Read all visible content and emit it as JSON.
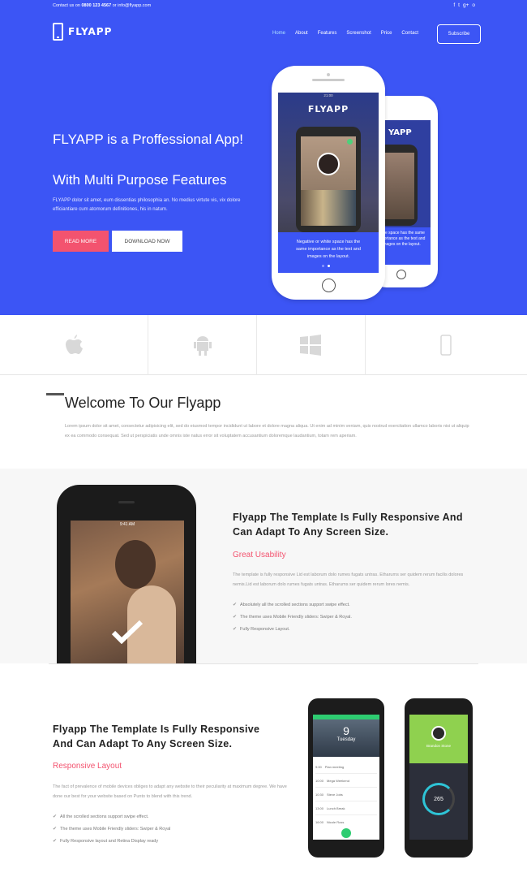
{
  "topbar": {
    "contact_prefix": "Contact us on",
    "phone": "0800 123 4567",
    "or": "or",
    "email": "info@flyapp.com"
  },
  "social_icons": [
    "facebook-icon",
    "twitter-icon",
    "googleplus-icon",
    "github-icon"
  ],
  "social_glyphs": [
    "f",
    "t",
    "g+",
    "o"
  ],
  "brand": {
    "name": "FLYAPP"
  },
  "nav": {
    "items": [
      "Home",
      "About",
      "Features",
      "Screenshot",
      "Price",
      "Contact"
    ],
    "active": "Home",
    "subscribe": "Subscribe"
  },
  "hero": {
    "title": "FLYAPP is a Proffessional App!",
    "subtitle": "With Multi Purpose Features",
    "text": "FLYAPP dolor sit amet, eum dissentias philosophia an. No medius virtute vis, vix dolore efficiantiare cum atomorum definitiones, his in natum.",
    "read_more": "READ MORE",
    "download": "DOWNLOAD NOW",
    "phone_logo": "FLYAPP",
    "phone_logo_partial": "YAPP",
    "phone_time": "21:00",
    "phone_caption": "Negative or white space has the same importance as the text and images on the layout.",
    "phone_caption_small": "white space has the same importance as the text and images on the layout.",
    "colors": {
      "hero_bg": "#3c55f5",
      "accent": "#f3536f"
    }
  },
  "platforms": [
    "apple-icon",
    "android-icon",
    "windows-icon",
    "phone-icon"
  ],
  "welcome": {
    "title": "Welcome To Our Flyapp",
    "text": "Lorem ipsum dolor sit amet, consectetur adipisicing elit, sed do eiusmod tempor incididunt ut labore et dolore magna aliqua. Ut enim ad minim veniam, quis nostrud exercitation ullamco laboris nisi ut aliquip ex ea commodo consequat. Sed ut perspiciatis unde omnis iste natus error sit voluptatem accusantium doloremque laudantium, totam rem aperiam."
  },
  "feature1": {
    "title": "Flyapp The Template Is Fully Responsive And Can Adapt To Any Screen Size.",
    "subtitle": "Great Usability",
    "text": "The template is fully responsive Lid est laborum dolo rumes fugats untras. Etharums ser quidem rerum facilis dolores nemis.Lid est laborum dolo rumes fugats untras. Etharums ser quidem rerum lores nemis.",
    "list": [
      "Absolutely all the scrolled sections support swipe effect.",
      "The theme uses Mobile Friendly sliders: Swiper & Royal.",
      "Fully Responsive Layout."
    ],
    "phone_time": "9:41 AM"
  },
  "feature2": {
    "title": "Flyapp The Template Is Fully Responsive And Can Adapt To Any Screen Size.",
    "subtitle": "Responsive Layout",
    "text": "The fact of prevalence of mobile devices obliges to adapt any website to their peculiarity at maximum degree. We have done our best for your website based on Punto to blend with this trend.",
    "list": [
      "All the scrolled sections support swipe effect.",
      "The theme uses Mobile Friendly sliders: Swiper & Royal",
      "Fully Responsive layout and Retina Display ready"
    ],
    "phone1": {
      "day": "9",
      "weekday": "Tuesday",
      "rows": [
        [
          "9:00",
          "Plan meeting"
        ],
        [
          "10:00",
          "Mega Weekend"
        ],
        [
          "10:30",
          "Steve Jobs"
        ],
        [
          "13:00",
          "Lunch Break"
        ],
        [
          "16:00",
          "Nicole Ross"
        ]
      ]
    },
    "phone2": {
      "name": "Brandon Stone",
      "value": "265"
    }
  }
}
